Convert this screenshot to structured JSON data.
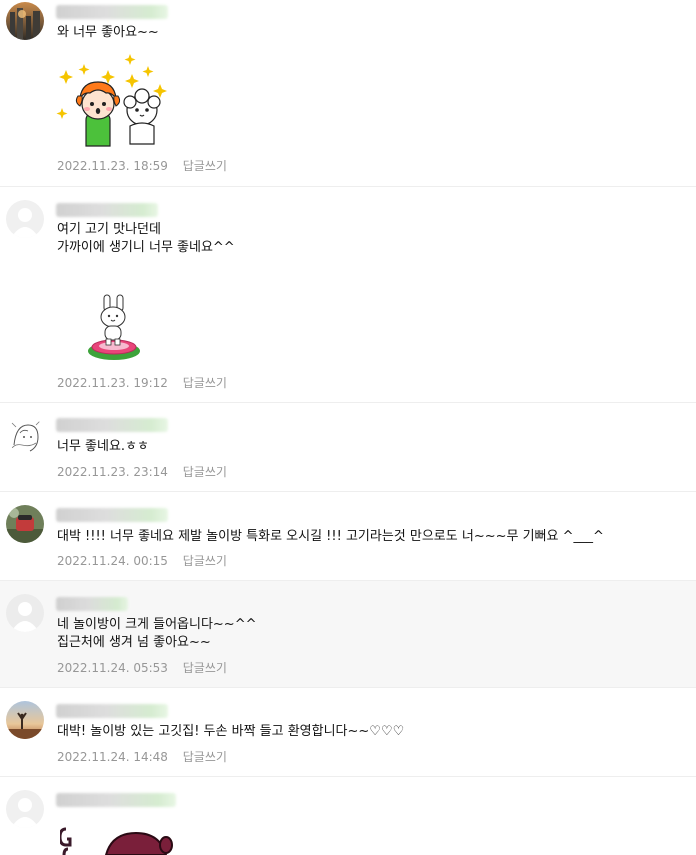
{
  "comments": [
    {
      "text": "와 너무 좋아요~~",
      "date": "2022.11.23. 18:59",
      "reply": "답글쓰기",
      "avatar": "landscape-photo-avatar",
      "sticker": "bear-and-sheep-sticker"
    },
    {
      "text": "여기 고기 맛나던데\n가까이에 생기니 너무 좋네요^^",
      "date": "2022.11.23. 19:12",
      "reply": "답글쓰기",
      "avatar": "default-avatar",
      "sticker": "bunny-trampoline-sticker"
    },
    {
      "text": "너무 좋네요.ㅎㅎ",
      "date": "2022.11.23. 23:14",
      "reply": "답글쓰기",
      "avatar": "sketch-avatar"
    },
    {
      "text": "대박 !!!! 너무 좋네요 제발 놀이방 특화로 오시길 !!! 고기라는것 만으로도 너~~~무 기뻐요 ^___^",
      "date": "2022.11.24. 00:15",
      "reply": "답글쓰기",
      "avatar": "photo-avatar"
    },
    {
      "text": "네 놀이방이 크게 들어옵니다~~^^\n집근처에 생겨 넘 좋아요~~",
      "date": "2022.11.24. 05:53",
      "reply": "답글쓰기",
      "avatar": "default-avatar",
      "highlighted": true
    },
    {
      "text": "대박! 놀이방 있는 고깃집! 두손 바짝 들고 환영합니다~~♡♡♡",
      "date": "2022.11.24. 14:48",
      "reply": "답글쓰기",
      "avatar": "sunset-photo-avatar"
    },
    {
      "avatar": "default-avatar",
      "sticker": "character-sticker-partial"
    }
  ],
  "colors": {
    "meta_text": "#979797",
    "divider": "#eeeeee",
    "highlight_bg": "#f7f7f7",
    "body_text": "#111111"
  }
}
